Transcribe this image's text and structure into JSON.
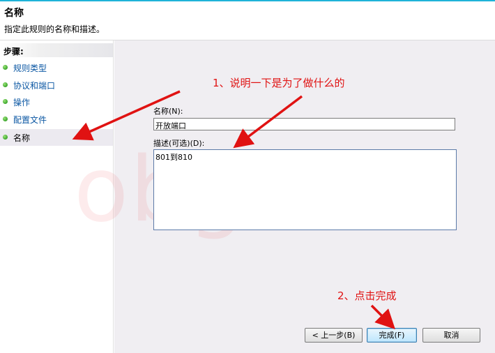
{
  "header": {
    "title": "名称",
    "subtitle": "指定此规则的名称和描述。"
  },
  "sidebar": {
    "steps_label": "步骤:",
    "steps": [
      {
        "label": "规则类型"
      },
      {
        "label": "协议和端口"
      },
      {
        "label": "操作"
      },
      {
        "label": "配置文件"
      },
      {
        "label": "名称"
      }
    ]
  },
  "form": {
    "name_label": "名称(N):",
    "name_value": "开放端口",
    "desc_label": "描述(可选)(D):",
    "desc_value": "801到810"
  },
  "buttons": {
    "back": "< 上一步(B)",
    "finish": "完成(F)",
    "cancel": "取消"
  },
  "annotations": {
    "note1": "1、说明一下是为了做什么的",
    "note2": "2、点击完成",
    "color": "#e01212"
  },
  "watermark": "obge"
}
